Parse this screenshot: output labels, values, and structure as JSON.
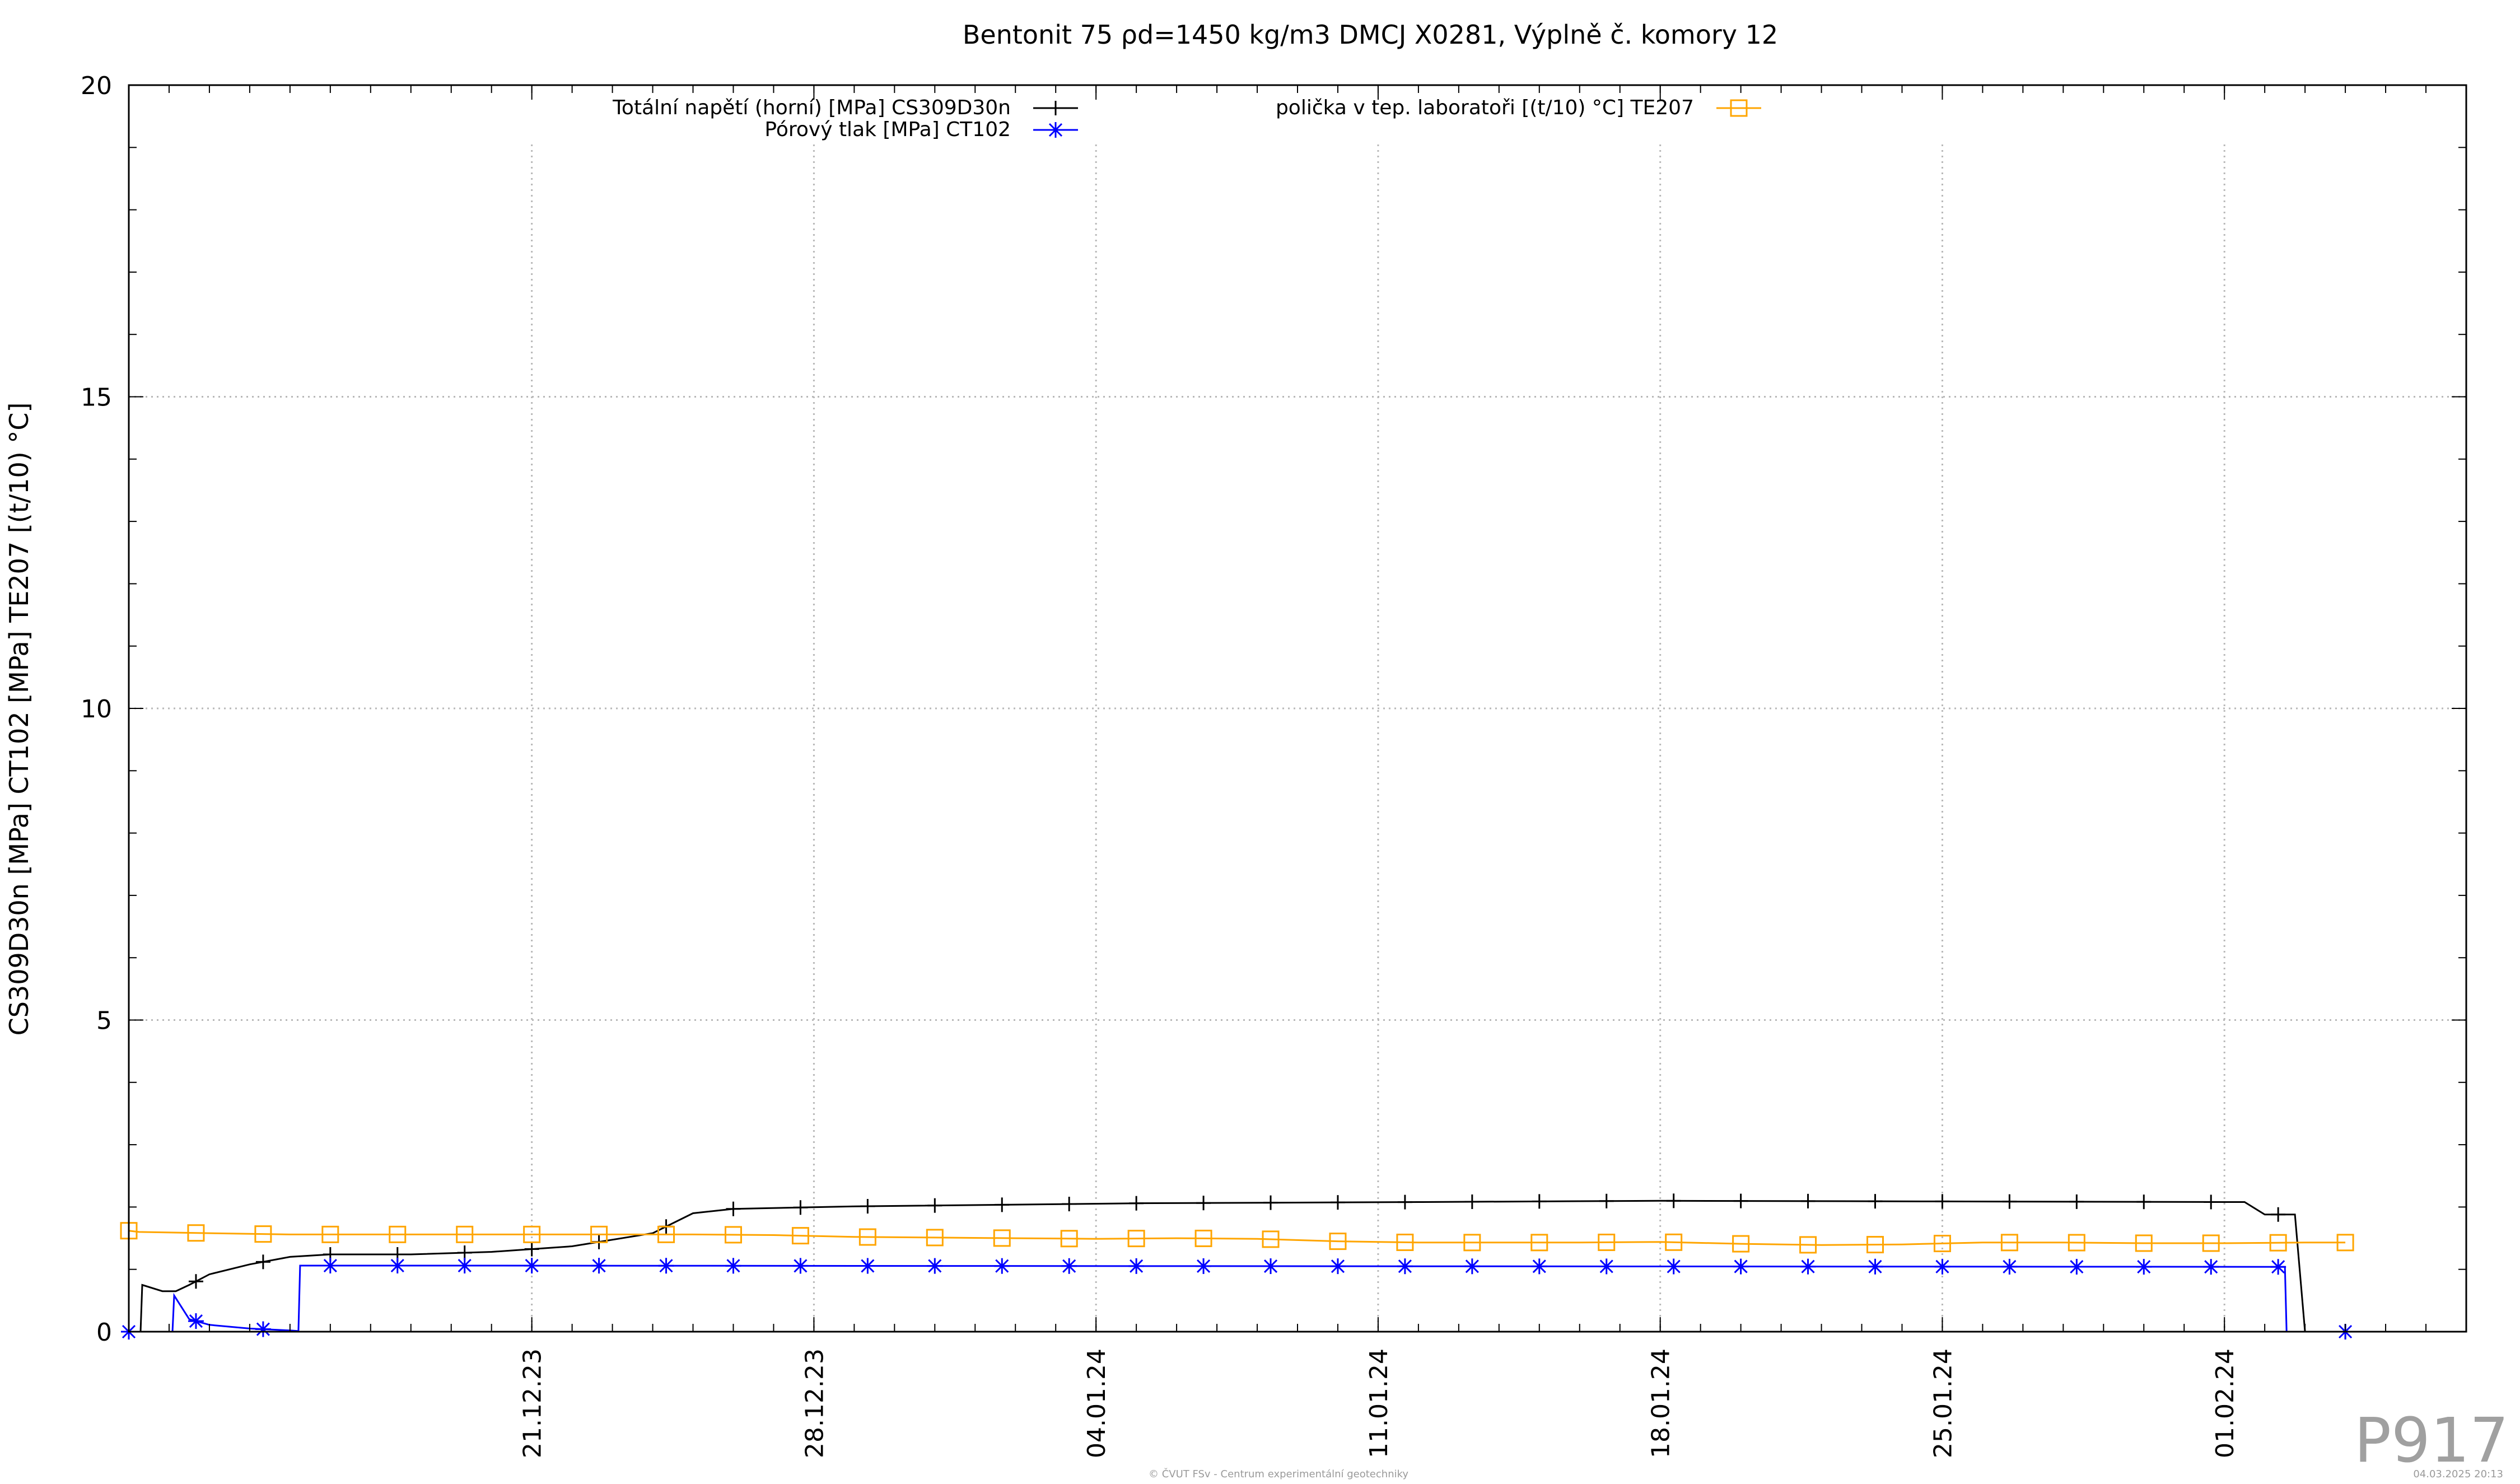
{
  "chart_data": {
    "type": "line",
    "title": "Bentonit 75 ρd=1450 kg/m3 DMCJ X0281, Výplně č. komory 12",
    "ylabel": "CS309D30n [MPa] CT102 [MPa] TE207 [(t/10) °C]",
    "xlabel": "",
    "ylim": [
      0,
      20
    ],
    "yticks": [
      0,
      5,
      10,
      15,
      20
    ],
    "xlim": [
      "2023-12-11",
      "2024-02-07"
    ],
    "xticks": [
      "2023-12-21",
      "2023-12-28",
      "2024-01-04",
      "2024-01-11",
      "2024-01-18",
      "2024-01-25",
      "2024-02-01"
    ],
    "xtick_labels": [
      "21.12.23",
      "28.12.23",
      "04.01.24",
      "11.01.24",
      "18.01.24",
      "25.01.24",
      "01.02.24"
    ],
    "grid": true,
    "series": [
      {
        "name": "Totální napětí (horní) [MPa] CS309D30n",
        "color": "#000000",
        "marker": "plus",
        "points": [
          {
            "x": "2023-12-11 00:00",
            "y": 0.0
          },
          {
            "x": "2023-12-11 07:00",
            "y": 0.0
          },
          {
            "x": "2023-12-11 08:00",
            "y": 0.75
          },
          {
            "x": "2023-12-11 20:00",
            "y": 0.65
          },
          {
            "x": "2023-12-12 02:00",
            "y": 0.65
          },
          {
            "x": "2023-12-12 04:00",
            "y": 0.65
          },
          {
            "x": "2023-12-12 12:00",
            "y": 0.75
          },
          {
            "x": "2023-12-13 00:00",
            "y": 0.92
          },
          {
            "x": "2023-12-14 00:00",
            "y": 1.08
          },
          {
            "x": "2023-12-15 00:00",
            "y": 1.2
          },
          {
            "x": "2023-12-16 00:00",
            "y": 1.24
          },
          {
            "x": "2023-12-18 00:00",
            "y": 1.24
          },
          {
            "x": "2023-12-20 00:00",
            "y": 1.28
          },
          {
            "x": "2023-12-22 00:00",
            "y": 1.37
          },
          {
            "x": "2023-12-24 00:00",
            "y": 1.58
          },
          {
            "x": "2023-12-25 00:00",
            "y": 1.9
          },
          {
            "x": "2023-12-26 00:00",
            "y": 1.97
          },
          {
            "x": "2023-12-29 00:00",
            "y": 2.01
          },
          {
            "x": "2024-01-05 00:00",
            "y": 2.06
          },
          {
            "x": "2024-01-12 00:00",
            "y": 2.08
          },
          {
            "x": "2024-01-18 00:00",
            "y": 2.1
          },
          {
            "x": "2024-01-25 00:00",
            "y": 2.09
          },
          {
            "x": "2024-02-01 00:00",
            "y": 2.08
          },
          {
            "x": "2024-02-01 12:00",
            "y": 2.08
          },
          {
            "x": "2024-02-02 00:00",
            "y": 1.88
          },
          {
            "x": "2024-02-02 18:00",
            "y": 1.88
          },
          {
            "x": "2024-02-03 00:00",
            "y": 0.0
          },
          {
            "x": "2024-02-04 00:00",
            "y": 0.0
          }
        ]
      },
      {
        "name": "Pórový tlak [MPa] CT102",
        "color": "#0000ff",
        "marker": "star",
        "points": [
          {
            "x": "2023-12-11 00:00",
            "y": 0.0
          },
          {
            "x": "2023-12-11 18:00",
            "y": 0.0
          },
          {
            "x": "2023-12-12 02:00",
            "y": 0.0
          },
          {
            "x": "2023-12-12 03:00",
            "y": 0.58
          },
          {
            "x": "2023-12-12 12:00",
            "y": 0.2
          },
          {
            "x": "2023-12-13 00:00",
            "y": 0.11
          },
          {
            "x": "2023-12-14 00:00",
            "y": 0.05
          },
          {
            "x": "2023-12-15 00:00",
            "y": 0.02
          },
          {
            "x": "2023-12-15 05:00",
            "y": 0.01
          },
          {
            "x": "2023-12-15 06:00",
            "y": 1.06
          },
          {
            "x": "2023-12-20 00:00",
            "y": 1.06
          },
          {
            "x": "2024-01-10 00:00",
            "y": 1.05
          },
          {
            "x": "2024-02-02 12:00",
            "y": 1.04
          },
          {
            "x": "2024-02-02 13:00",
            "y": 0.0
          },
          {
            "x": "2024-02-04 00:00",
            "y": 0.0
          }
        ]
      },
      {
        "name": "polička v tep. laboratoři [(t/10) °C] TE207",
        "color": "#ffa500",
        "marker": "square",
        "points": [
          {
            "x": "2023-12-11 00:00",
            "y": 1.62
          },
          {
            "x": "2023-12-11 06:00",
            "y": 1.6
          },
          {
            "x": "2023-12-13 00:00",
            "y": 1.58
          },
          {
            "x": "2023-12-15 00:00",
            "y": 1.56
          },
          {
            "x": "2023-12-17 00:00",
            "y": 1.56
          },
          {
            "x": "2023-12-19 00:00",
            "y": 1.56
          },
          {
            "x": "2023-12-21 00:00",
            "y": 1.56
          },
          {
            "x": "2023-12-23 00:00",
            "y": 1.56
          },
          {
            "x": "2023-12-25 00:00",
            "y": 1.56
          },
          {
            "x": "2023-12-27 00:00",
            "y": 1.55
          },
          {
            "x": "2023-12-29 00:00",
            "y": 1.52
          },
          {
            "x": "2023-12-31 00:00",
            "y": 1.51
          },
          {
            "x": "2024-01-02 00:00",
            "y": 1.5
          },
          {
            "x": "2024-01-04 00:00",
            "y": 1.49
          },
          {
            "x": "2024-01-06 00:00",
            "y": 1.5
          },
          {
            "x": "2024-01-08 00:00",
            "y": 1.49
          },
          {
            "x": "2024-01-10 00:00",
            "y": 1.45
          },
          {
            "x": "2024-01-12 00:00",
            "y": 1.43
          },
          {
            "x": "2024-01-14 00:00",
            "y": 1.43
          },
          {
            "x": "2024-01-16 00:00",
            "y": 1.43
          },
          {
            "x": "2024-01-18 00:00",
            "y": 1.44
          },
          {
            "x": "2024-01-20 00:00",
            "y": 1.41
          },
          {
            "x": "2024-01-22 00:00",
            "y": 1.39
          },
          {
            "x": "2024-01-24 00:00",
            "y": 1.4
          },
          {
            "x": "2024-01-26 00:00",
            "y": 1.43
          },
          {
            "x": "2024-01-28 00:00",
            "y": 1.43
          },
          {
            "x": "2024-01-30 00:00",
            "y": 1.42
          },
          {
            "x": "2024-02-01 00:00",
            "y": 1.42
          },
          {
            "x": "2024-02-03 00:00",
            "y": 1.43
          },
          {
            "x": "2024-02-04 00:00",
            "y": 1.43
          }
        ]
      }
    ]
  },
  "footer": {
    "copyright": "© ČVUT FSv - Centrum experimentální geotechniky",
    "timestamp": "04.03.2025 20:13",
    "plot_id": "P917"
  }
}
